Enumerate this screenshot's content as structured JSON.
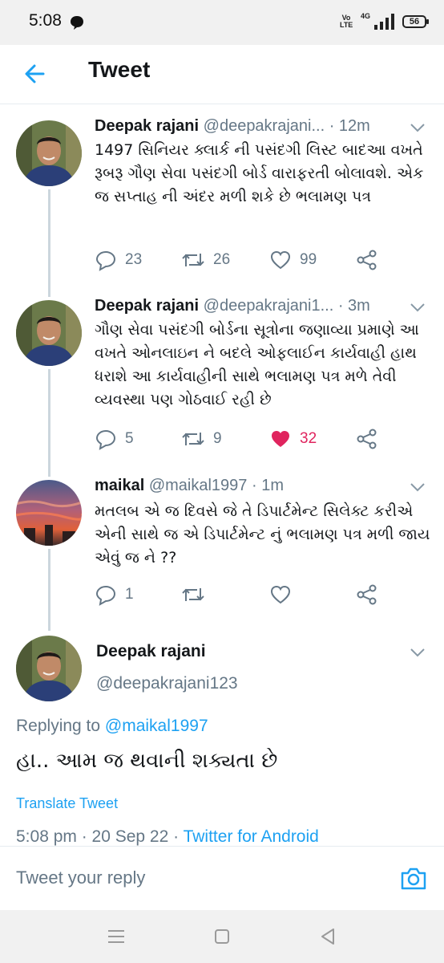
{
  "status_bar": {
    "time": "5:08",
    "volte": "Vo LTE",
    "network": "4G",
    "battery": "56"
  },
  "header": {
    "title": "Tweet"
  },
  "colors": {
    "accent": "#1da1f2",
    "like": "#e0245e",
    "muted": "#657786"
  },
  "tweets": [
    {
      "name": "Deepak rajani",
      "handle_time": "@deepakrajani... · 12m",
      "text": "1497 સિનિયર ક્લાર્ક ની પસંદગી લિસ્ટ બાદઆ વખતે રૂબરૂ ગૌણ સેવા પસંદગી બોર્ડ વારાફરતી બોલાવશે. એક જ સપ્તાહ ની અંદર મળી શકે છે ભલામણ પત્ર",
      "replies": "23",
      "retweets": "26",
      "likes": "99"
    },
    {
      "name": "Deepak rajani",
      "handle_time": "@deepakrajani1... · 3m",
      "text": "ગૌણ સેવા પસંદગી બોર્ડના સૂત્રોના જણાવ્યા પ્રમાણે આ વખતે ઓનલાઇન ને બદલે ઓફલાઈન કાર્યવાહી હાથ ધરાશે આ કાર્યવાહીની સાથે ભલામણ પત્ર મળે તેવી વ્યવસ્થા પણ ગોઠવાઈ રહી છે",
      "replies": "5",
      "retweets": "9",
      "likes": "32"
    },
    {
      "name": "maikal",
      "handle_time": "@maikal1997 · 1m",
      "text": "મતલબ એ જ દિવસે જે તે ડિપાર્ટમેન્ટ સિલેક્ટ કરીએ એની સાથે જ એ ડિપાર્ટમેન્ટ નું ભલામણ પત્ર મળી જાય એવું જ ને ??",
      "replies": "1",
      "retweets": "",
      "likes": ""
    }
  ],
  "focus": {
    "name": "Deepak rajani",
    "handle": "@deepakrajani123",
    "replying_prefix": "Replying to",
    "replying_to": "@maikal1997",
    "text": "હા.. આમ જ થવાની શક્યતા છે",
    "translate": "Translate Tweet",
    "timestamp": "5:08 pm · 20 Sep 22 ·",
    "source": "Twitter for Android"
  },
  "reply_bar": {
    "placeholder": "Tweet your reply"
  }
}
